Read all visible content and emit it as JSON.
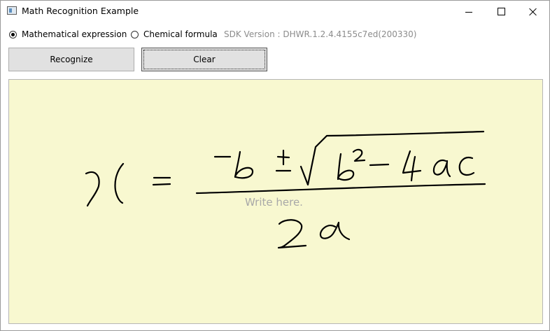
{
  "window": {
    "title": "Math Recognition Example",
    "icon": "app-icon"
  },
  "modes": {
    "options": [
      {
        "label": "Mathematical expression",
        "selected": true
      },
      {
        "label": "Chemical formula",
        "selected": false
      }
    ]
  },
  "sdk_version": "SDK Version : DHWR.1.2.4.4155c7ed(200330)",
  "buttons": {
    "recognize": "Recognize",
    "clear": "Clear"
  },
  "canvas": {
    "placeholder": "Write here.",
    "background": "#f8f8d0",
    "ink_color": "#000000"
  }
}
